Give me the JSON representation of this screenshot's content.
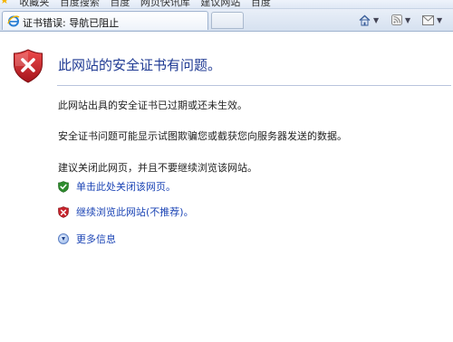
{
  "favorites_bar": {
    "items": [
      "收藏夹",
      "百度搜索",
      "百度",
      "网页快讯库",
      "建议网站",
      "百度"
    ]
  },
  "tab": {
    "title": "证书错误: 导航已阻止"
  },
  "command_bar": {
    "home_icon": "home-icon",
    "feeds_icon": "rss-icon",
    "mail_icon": "mail-icon"
  },
  "error_page": {
    "heading": "此网站的安全证书有问题。",
    "paragraph1": "此网站出具的安全证书已过期或还未生效。",
    "paragraph2": "安全证书问题可能显示试图欺骗您或截获您向服务器发送的数据。",
    "paragraph3": "建议关闭此网页，并且不要继续浏览该网站。",
    "close_link": "单击此处关闭该网页。",
    "continue_link": "继续浏览此网站(不推荐)。",
    "more_info": "更多信息"
  },
  "colors": {
    "heading": "#1f3a93",
    "link": "#1b44b5",
    "shield_red": "#c8232c",
    "safe_green": "#2e8b2e"
  }
}
